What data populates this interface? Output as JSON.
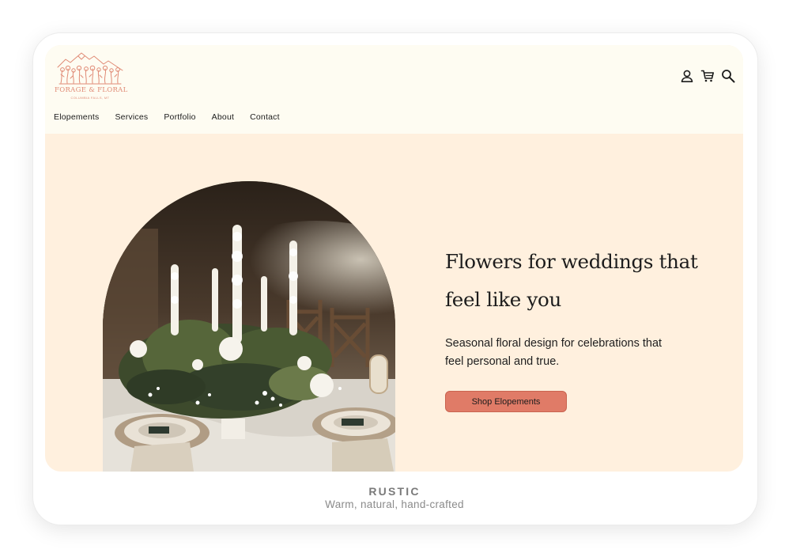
{
  "brand": {
    "name": "FORAGE & FLORAL",
    "location": "COLUMBIA FALLS, MT",
    "accent": "#e07b67"
  },
  "header": {
    "icons": [
      "account-icon",
      "cart-icon",
      "search-icon"
    ]
  },
  "nav": {
    "items": [
      {
        "label": "Elopements"
      },
      {
        "label": "Services"
      },
      {
        "label": "Portfolio"
      },
      {
        "label": "About"
      },
      {
        "label": "Contact"
      }
    ]
  },
  "hero": {
    "heading": "Flowers for weddings that feel like you",
    "subheading": "Seasonal floral design for celebrations that feel personal and true.",
    "cta_label": "Shop Elopements",
    "background_color": "#fff0de"
  },
  "caption": {
    "style_name": "RUSTIC",
    "style_description": "Warm, natural, hand-crafted"
  }
}
